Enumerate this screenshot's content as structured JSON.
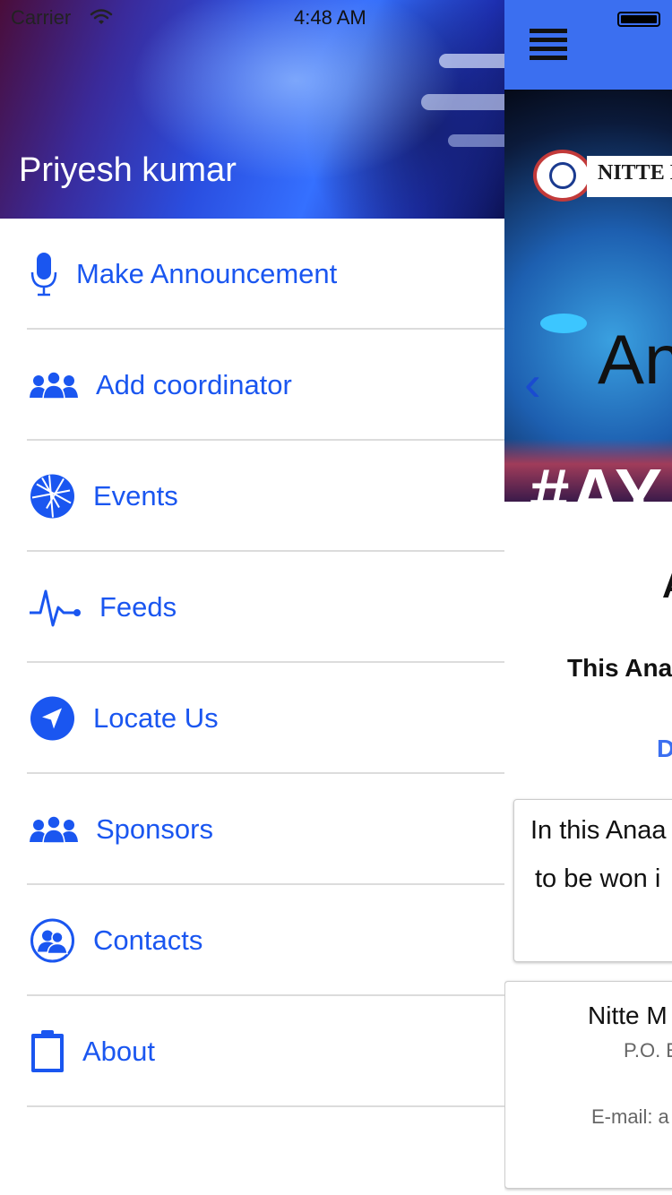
{
  "status_bar": {
    "carrier": "Carrier",
    "time": "4:48 AM"
  },
  "drawer": {
    "user_name": "Priyesh kumar",
    "items": [
      {
        "label": "Make Announcement",
        "icon": "microphone-icon"
      },
      {
        "label": "Add coordinator",
        "icon": "group-icon"
      },
      {
        "label": "Events",
        "icon": "aperture-icon"
      },
      {
        "label": "Feeds",
        "icon": "pulse-icon"
      },
      {
        "label": "Locate Us",
        "icon": "location-arrow-icon"
      },
      {
        "label": "Sponsors",
        "icon": "group-icon"
      },
      {
        "label": "Contacts",
        "icon": "contacts-icon"
      },
      {
        "label": "About",
        "icon": "clipboard-icon"
      }
    ]
  },
  "main": {
    "banner": {
      "brand": "NITTE N",
      "title": "An",
      "hashtag": "#AY"
    },
    "heading": "A",
    "subheading": "This Ana",
    "link": "D",
    "card1": {
      "line1": "In this Anaa",
      "line2": "to be won i"
    },
    "card2": {
      "name": "Nitte M",
      "po": "P.O. E",
      "email": "E-mail: a"
    }
  },
  "colors": {
    "accent": "#1a56f0",
    "topbar": "#3b6ff0"
  }
}
